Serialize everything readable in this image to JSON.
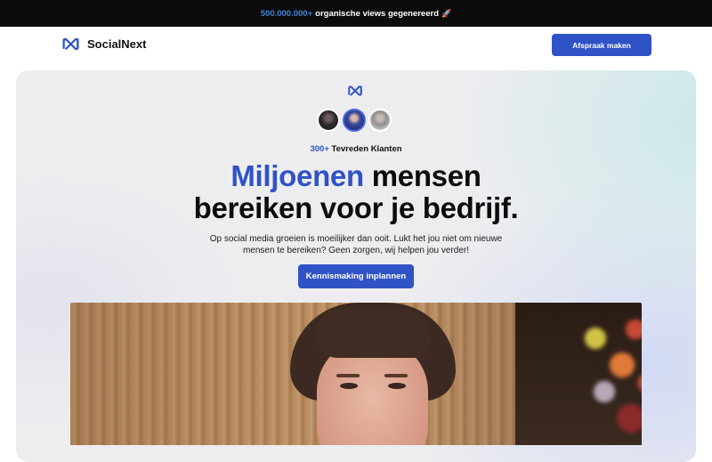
{
  "announcement": {
    "number": "500.000.000+",
    "text": "organische views gegenereerd",
    "emoji": "🚀"
  },
  "nav": {
    "brand_name": "SocialNext",
    "logo_icon": "socialnext-logo-icon",
    "cta_label": "Afspraak maken"
  },
  "hero": {
    "logo_icon": "socialnext-logo-icon",
    "clients": {
      "count": "300+",
      "label": "Tevreden Klanten"
    },
    "headline": {
      "highlight": "Miljoenen",
      "rest_line1": "mensen",
      "line2": "bereiken voor je bedrijf."
    },
    "subtext": "Op social media groeien is moeilijker dan ooit. Lukt het jou niet om nieuwe mensen te bereiken? Geen zorgen, wij helpen jou verder!",
    "cta_label": "Kennismaking inplannen"
  },
  "colors": {
    "accent": "#2f52c6",
    "announcement_bg": "#0b0b0b",
    "announcement_number": "#3f87d8"
  }
}
